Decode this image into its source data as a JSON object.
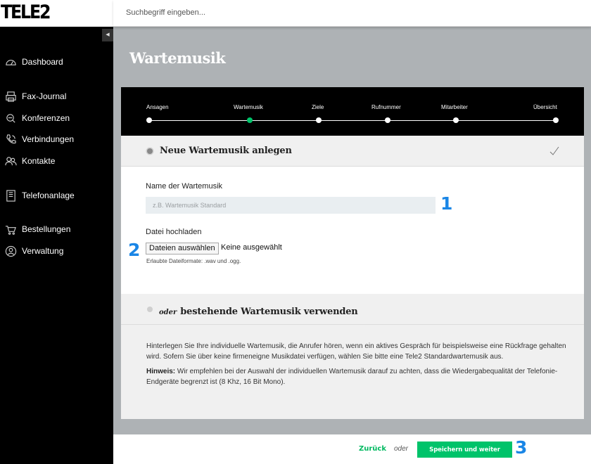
{
  "header": {
    "logo_text": "TELE2",
    "search_placeholder": "Suchbegriff eingeben..."
  },
  "sidebar": {
    "collapse_glyph": "◀",
    "items": [
      {
        "label": "Dashboard",
        "icon": "dashboard-icon"
      },
      {
        "label": "Fax-Journal",
        "icon": "fax-icon"
      },
      {
        "label": "Konferenzen",
        "icon": "conference-icon"
      },
      {
        "label": "Verbindungen",
        "icon": "phone-icon"
      },
      {
        "label": "Kontakte",
        "icon": "contacts-icon"
      },
      {
        "label": "Telefonanlage",
        "icon": "phone-system-icon"
      },
      {
        "label": "Bestellungen",
        "icon": "cart-icon"
      },
      {
        "label": "Verwaltung",
        "icon": "user-admin-icon"
      }
    ]
  },
  "page": {
    "title": "Wartemusik"
  },
  "stepper": {
    "steps": [
      "Ansagen",
      "Wartemusik",
      "Ziele",
      "Rufnummer",
      "Mitarbeiter",
      "Übersicht"
    ],
    "active_step": "Wartemusik"
  },
  "section_new": {
    "title": "Neue Wartemusik anlegen",
    "name_label": "Name der Wartemusik",
    "name_placeholder": "z.B. Wartemusik Standard",
    "upload_label": "Datei hochladen",
    "file_button": "Dateien auswählen",
    "file_status": "Keine ausgewählt",
    "file_hint": "Erlaubte Dateiformate: .wav und .ogg."
  },
  "section_existing": {
    "prefix": "oder",
    "title": "bestehende Wartemusik verwenden"
  },
  "description": {
    "paragraph": "Hinterlegen Sie Ihre individuelle Wartemusik, die Anrufer hören, wenn ein aktives Gespräch für beispielsweise eine Rückfrage gehalten wird. Sofern Sie über keine firmeneigne Musikdatei verfügen, wählen Sie bitte eine Tele2 Standardwartemusik aus.",
    "hint_label": "Hinweis:",
    "hint_text": "Wir empfehlen bei der Auswahl der individuellen Wartemusik darauf zu achten, dass die Wiedergabequalität der Telefonie-Endgeräte begrenzt ist (8 Khz, 16 Bit Mono)."
  },
  "footer": {
    "back": "Zurück",
    "or": "oder",
    "save": "Speichern und weiter"
  },
  "annotations": [
    "1",
    "2",
    "3"
  ],
  "colors": {
    "accent_green": "#00c36a",
    "annotation_blue": "#1a86e6",
    "sidebar_bg": "#000000",
    "page_bg": "#aeb2b5"
  }
}
